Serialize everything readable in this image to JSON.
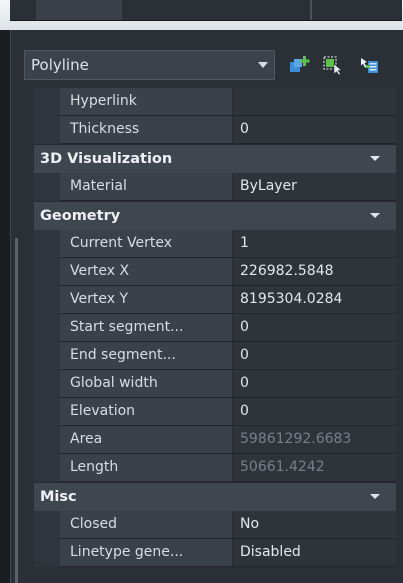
{
  "selector": {
    "value": "Polyline"
  },
  "toolbar": {
    "icons": [
      "toggle-pickadd-icon",
      "select-objects-icon",
      "quick-select-icon"
    ],
    "colors": {
      "blue": "#3a8fd6",
      "green": "#5cc24a",
      "gray": "#c9cfd6"
    }
  },
  "grid": {
    "top_rows": [
      {
        "label": "Hyperlink",
        "value": ""
      },
      {
        "label": "Thickness",
        "value": "0"
      }
    ],
    "visualization": {
      "title": "3D Visualization",
      "rows": [
        {
          "label": "Material",
          "value": "ByLayer"
        }
      ]
    },
    "geometry": {
      "title": "Geometry",
      "rows": [
        {
          "label": "Current Vertex",
          "value": "1"
        },
        {
          "label": "Vertex X",
          "value": "226982.5848"
        },
        {
          "label": "Vertex Y",
          "value": "8195304.0284"
        },
        {
          "label": "Start segment...",
          "value": "0"
        },
        {
          "label": "End segment...",
          "value": "0"
        },
        {
          "label": "Global width",
          "value": "0"
        },
        {
          "label": "Elevation",
          "value": "0"
        },
        {
          "label": "Area",
          "value": "59861292.6683"
        },
        {
          "label": "Length",
          "value": "50661.4242"
        }
      ]
    },
    "misc": {
      "title": "Misc",
      "rows": [
        {
          "label": "Closed",
          "value": "No"
        },
        {
          "label": "Linetype gene...",
          "value": "Disabled"
        }
      ]
    }
  }
}
